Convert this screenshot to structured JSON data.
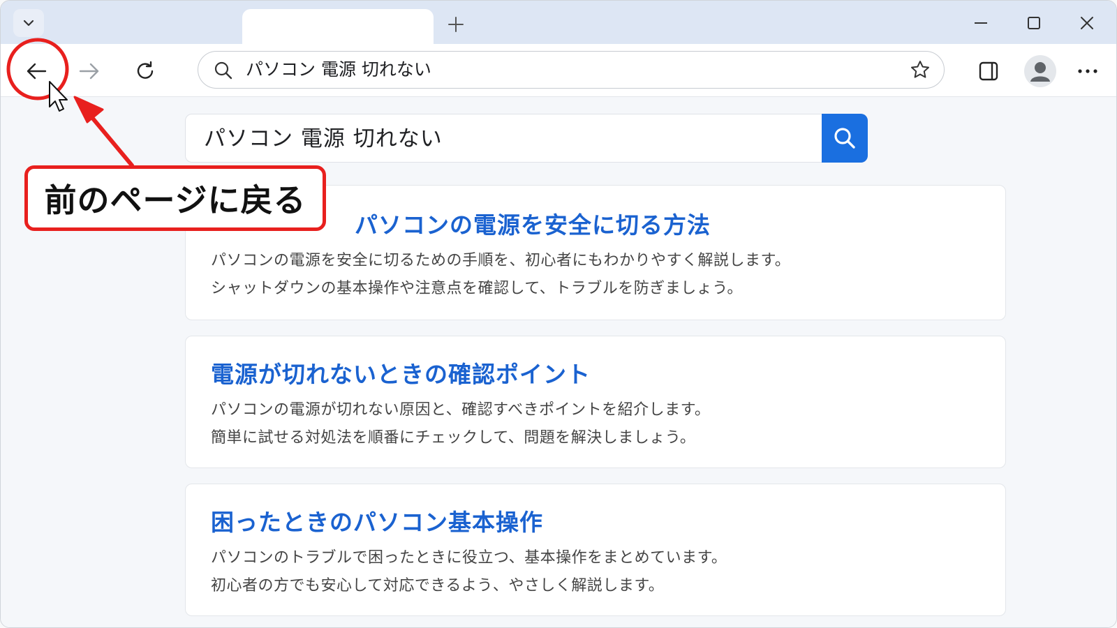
{
  "browser": {
    "address_text": "パソコン 電源 切れない",
    "window_controls": [
      "minimize-icon",
      "maximize-icon",
      "close-icon"
    ]
  },
  "search": {
    "query": "パソコン 電源 切れない"
  },
  "results": [
    {
      "title": "パソコンの電源を安全に切る方法",
      "line1": "パソコンの電源を安全に切るための手順を、初心者にもわかりやすく解説します。",
      "line2": "シャットダウンの基本操作や注意点を確認して、トラブルを防ぎましょう。"
    },
    {
      "title": "電源が切れないときの確認ポイント",
      "line1": "パソコンの電源が切れない原因と、確認すべきポイントを紹介します。",
      "line2": "簡単に試せる対処法を順番にチェックして、問題を解決しましょう。"
    },
    {
      "title": "困ったときのパソコン基本操作",
      "line1": "パソコンのトラブルで困ったときに役立つ、基本操作をまとめています。",
      "line2": "初心者の方でも安心して対応できるよう、やさしく解説します。"
    }
  ],
  "annotation": {
    "label": "前のページに戻る",
    "color": "#e8201e"
  },
  "colors": {
    "accent": "#1a6fe0",
    "link": "#1a62d0"
  }
}
